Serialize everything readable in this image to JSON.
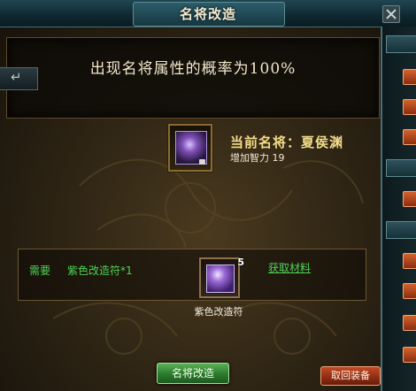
{
  "window": {
    "title": "名将改造"
  },
  "banner": {
    "probability_text": "出现名将属性的概率为100%"
  },
  "general": {
    "current_label": "当前名将：夏侯渊",
    "bonus_text": "增加智力 19"
  },
  "requirement": {
    "label": "需要",
    "item_text": "紫色改造符*1",
    "item_count": "5",
    "item_caption": "紫色改造符",
    "acquire_link": "获取材料"
  },
  "buttons": {
    "modify": "名将改造",
    "return_equipment": "取回装备"
  },
  "colors": {
    "accent_green": "#4ed356",
    "gold_text": "#f3dd8a",
    "title_bar": "#1f4652"
  },
  "icons": {
    "general_portrait": "general-portrait-icon",
    "rune": "purple-rune-icon",
    "close": "close-icon",
    "back": "back-arrow-icon"
  }
}
